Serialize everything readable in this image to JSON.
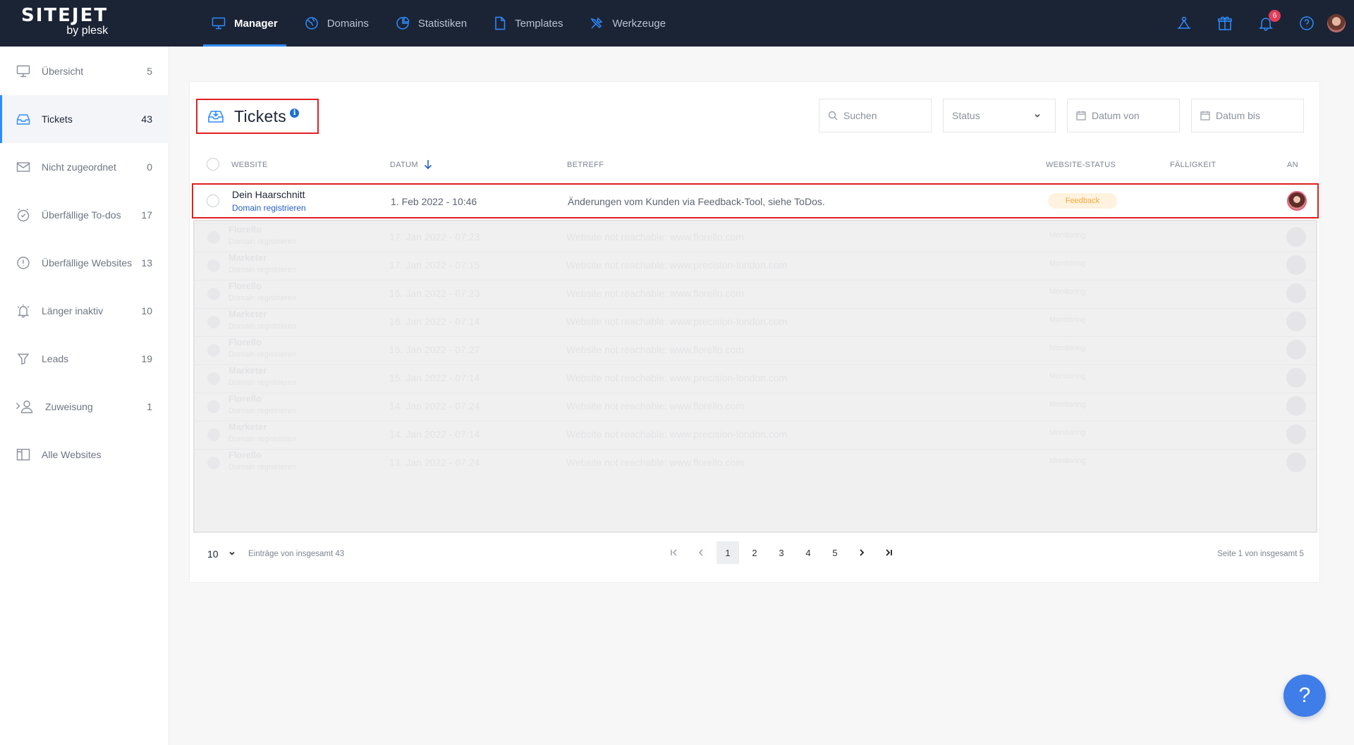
{
  "logo": {
    "brand": "SITEJET",
    "sub": "by plesk"
  },
  "nav": [
    {
      "label": "Manager",
      "icon": "monitor-icon",
      "active": true
    },
    {
      "label": "Domains",
      "icon": "globe-icon"
    },
    {
      "label": "Statistiken",
      "icon": "pie-chart-icon"
    },
    {
      "label": "Templates",
      "icon": "document-icon"
    },
    {
      "label": "Werkzeuge",
      "icon": "tools-icon"
    }
  ],
  "topbar": {
    "notification_count": "6"
  },
  "sidebar": {
    "items": [
      {
        "label": "Übersicht",
        "count": "5",
        "icon": "monitor-icon"
      },
      {
        "label": "Tickets",
        "count": "43",
        "icon": "inbox-icon",
        "active": true
      },
      {
        "label": "Nicht zugeordnet",
        "count": "0",
        "icon": "mail-icon"
      },
      {
        "label": "Überfällige To-dos",
        "count": "17",
        "icon": "clock-icon"
      },
      {
        "label": "Überfällige Websites",
        "count": "13",
        "icon": "alert-icon"
      },
      {
        "label": "Länger inaktiv",
        "count": "10",
        "icon": "bell-icon"
      },
      {
        "label": "Leads",
        "count": "19",
        "icon": "funnel-icon"
      },
      {
        "label": "Zuweisung",
        "count": "1",
        "icon": "user-assign-icon"
      },
      {
        "label": "Alle Websites",
        "count": "",
        "icon": "columns-icon"
      }
    ]
  },
  "main": {
    "title": "Tickets",
    "info": "i",
    "filters": {
      "search_placeholder": "Suchen",
      "status": "Status",
      "date_from": "Datum von",
      "date_to": "Datum bis"
    },
    "columns": {
      "website": "WEBSITE",
      "datum": "DATUM",
      "betreff": "BETREFF",
      "status": "WEBSITE-STATUS",
      "faelligkeit": "FÄLLIGKEIT",
      "an": "AN"
    },
    "rows": [
      {
        "website": "Dein Haarschnitt",
        "link": "Domain registrieren",
        "datum": "1. Feb 2022 - 10:46",
        "betreff": "Änderungen vom Kunden via Feedback-Tool, siehe ToDos.",
        "status": "Feedback"
      }
    ],
    "ghost_rows": [
      {
        "website": "Florello",
        "link": "Domain registrieren",
        "datum": "17. Jan 2022 - 07:23",
        "betreff": "Website not reachable: www.florello.com",
        "status": "Monitoring"
      },
      {
        "website": "Marketer",
        "link": "Domain registrieren",
        "datum": "17. Jan 2022 - 07:15",
        "betreff": "Website not reachable: www.precision-london.com",
        "status": "Monitoring"
      },
      {
        "website": "Florello",
        "link": "Domain registrieren",
        "datum": "16. Jan 2022 - 07:23",
        "betreff": "Website not reachable: www.florello.com",
        "status": "Monitoring"
      },
      {
        "website": "Marketer",
        "link": "Domain registrieren",
        "datum": "16. Jan 2022 - 07:14",
        "betreff": "Website not reachable: www.precision-london.com",
        "status": "Monitoring"
      },
      {
        "website": "Florello",
        "link": "Domain registrieren",
        "datum": "15. Jan 2022 - 07:27",
        "betreff": "Website not reachable: www.florello.com",
        "status": "Monitoring"
      },
      {
        "website": "Marketer",
        "link": "Domain registrieren",
        "datum": "15. Jan 2022 - 07:14",
        "betreff": "Website not reachable: www.precision-london.com",
        "status": "Monitoring"
      },
      {
        "website": "Florello",
        "link": "Domain registrieren",
        "datum": "14. Jan 2022 - 07:24",
        "betreff": "Website not reachable: www.florello.com",
        "status": "Monitoring"
      },
      {
        "website": "Marketer",
        "link": "Domain registrieren",
        "datum": "14. Jan 2022 - 07:14",
        "betreff": "Website not reachable: www.precision-london.com",
        "status": "Monitoring"
      },
      {
        "website": "Florello",
        "link": "Domain registrieren",
        "datum": "13. Jan 2022 - 07:24",
        "betreff": "Website not reachable: www.florello.com",
        "status": "Monitoring"
      }
    ],
    "footer": {
      "per_page": "10",
      "entries_text": "Einträge von insgesamt 43",
      "pages": [
        "1",
        "2",
        "3",
        "4",
        "5"
      ],
      "current_page": "1",
      "page_info": "Seite 1 von insgesamt 5"
    }
  },
  "help_button": "?"
}
